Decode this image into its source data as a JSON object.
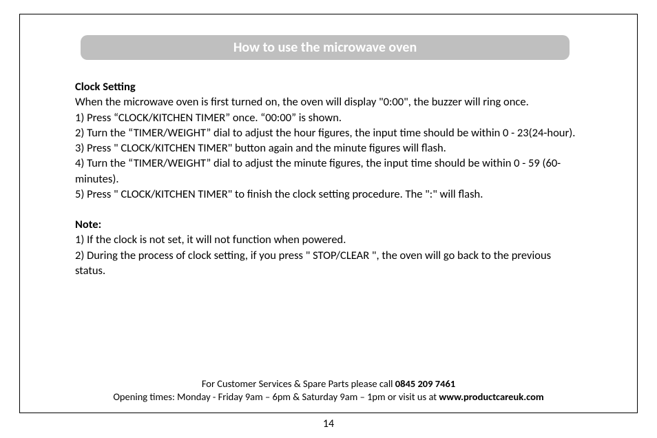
{
  "title": "How to use the microwave oven",
  "section": {
    "heading": "Clock Setting",
    "intro": "When the microwave oven is first turned on, the oven will display \"0:00\", the buzzer will ring once.",
    "steps": [
      "1) Press “CLOCK/KITCHEN TIMER” once. “00:00” is shown.",
      "2) Turn the “TIMER/WEIGHT” dial to adjust the hour figures, the input time should be within 0 - 23(24-hour).",
      "3) Press \" CLOCK/KITCHEN TIMER\" button again and the minute figures will flash.",
      "4) Turn the “TIMER/WEIGHT” dial to adjust the minute figures, the input time should be within 0 - 59 (60-minutes).",
      "5) Press \" CLOCK/KITCHEN TIMER\" to finish the clock setting procedure. The \":\" will flash."
    ],
    "noteHeading": "Note:",
    "notes": [
      "1) If the clock is not set, it will not function when powered.",
      "2) During the process of clock setting, if you press \" STOP/CLEAR \", the oven will go back to the previous status."
    ]
  },
  "footer": {
    "line1_pre": "For Customer Services & Spare Parts please call ",
    "phone": "0845 209 7461",
    "line2_pre": "Opening times: Monday - Friday  9am – 6pm & Saturday 9am – 1pm or visit us at ",
    "site": "www.productcareuk.com"
  },
  "pageNumber": "14"
}
